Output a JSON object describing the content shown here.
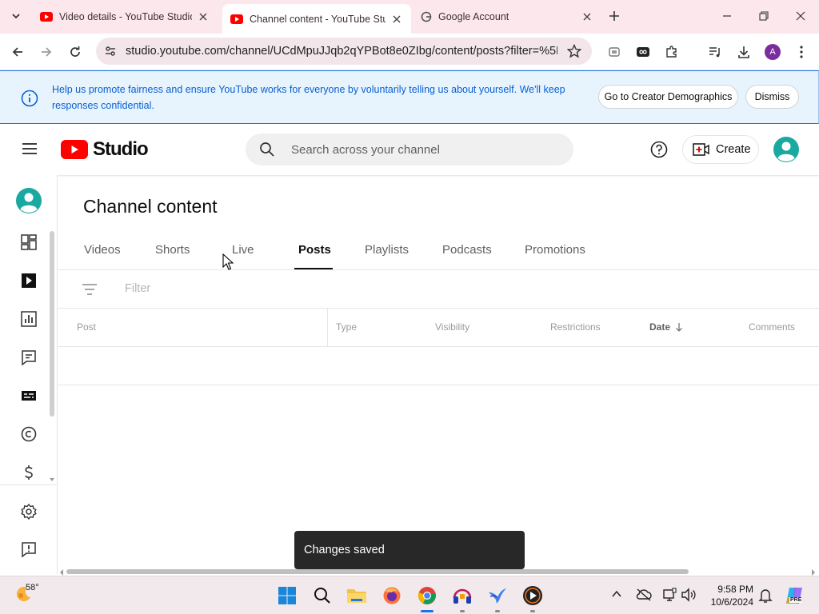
{
  "browser": {
    "tabs": [
      {
        "title": "Video details - YouTube Studio",
        "active": false
      },
      {
        "title": "Channel content - YouTube Studio",
        "active": true
      },
      {
        "title": "Google Account",
        "active": false
      }
    ],
    "url": "studio.youtube.com/channel/UCdMpuJJqb2qYPBot8e0ZIbg/content/posts?filter=%5B...",
    "profile_initial": "A",
    "accent_color": "#fce8ec"
  },
  "banner": {
    "text": "Help us promote fairness and ensure YouTube works for everyone by voluntarily telling us about yourself. We'll keep responses confidential.",
    "primary_button": "Go to Creator Demographics",
    "dismiss_button": "Dismiss"
  },
  "header": {
    "logo_text": "Studio",
    "search_placeholder": "Search across your channel",
    "create_label": "Create",
    "brand_color": "#ff0000"
  },
  "sidenav": {
    "items": [
      "avatar",
      "dashboard-icon",
      "content-icon",
      "analytics-icon",
      "comments-icon",
      "subtitles-icon",
      "copyright-icon",
      "earn-icon",
      "settings-icon",
      "feedback-icon"
    ]
  },
  "main": {
    "title": "Channel content",
    "tabs": [
      "Videos",
      "Shorts",
      "Live",
      "Posts",
      "Playlists",
      "Podcasts",
      "Promotions"
    ],
    "active_tab": "Posts",
    "filter_placeholder": "Filter",
    "columns": [
      "Post",
      "Type",
      "Visibility",
      "Restrictions",
      "Date",
      "Comments"
    ],
    "sorted_column": "Date"
  },
  "toast": {
    "message": "Changes saved"
  },
  "taskbar": {
    "weather_temp": "58°",
    "time": "9:58 PM",
    "date": "10/6/2024",
    "copilot_badge": "PRE"
  }
}
